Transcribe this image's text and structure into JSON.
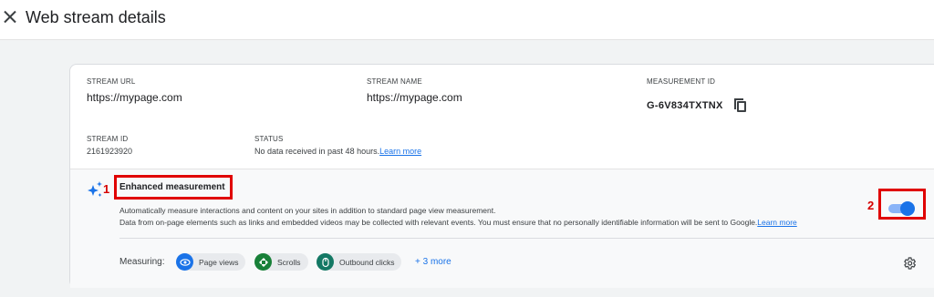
{
  "header": {
    "title": "Web stream details",
    "close_icon": "close-icon"
  },
  "stream": {
    "url_label": "STREAM URL",
    "url_value": "https://mypage.com",
    "name_label": "STREAM NAME",
    "name_value": "https://mypage.com",
    "measurement_label": "MEASUREMENT ID",
    "measurement_value": "G-6V834TXTNX",
    "id_label": "STREAM ID",
    "id_value": "2161923920",
    "status_label": "STATUS",
    "status_value": "No data received in past 48 hours.",
    "status_link": "Learn more"
  },
  "enhanced": {
    "title": "Enhanced measurement",
    "desc1": "Automatically measure interactions and content on your sites in addition to standard page view measurement.",
    "desc2": "Data from on-page elements such as links and embedded videos may be collected with relevant events. You must ensure that no personally identifiable information will be sent to Google.",
    "desc_link": "Learn more",
    "enabled": true,
    "measuring_label": "Measuring:",
    "chips": [
      {
        "label": "Page views",
        "icon": "eye-icon"
      },
      {
        "label": "Scrolls",
        "icon": "scroll-icon"
      },
      {
        "label": "Outbound clicks",
        "icon": "cursor-icon"
      }
    ],
    "more_label": "+ 3 more"
  },
  "annotations": {
    "marker_1": "1",
    "marker_2": "2"
  },
  "colors": {
    "accent": "#1a73e8",
    "highlight": "#e00000"
  }
}
